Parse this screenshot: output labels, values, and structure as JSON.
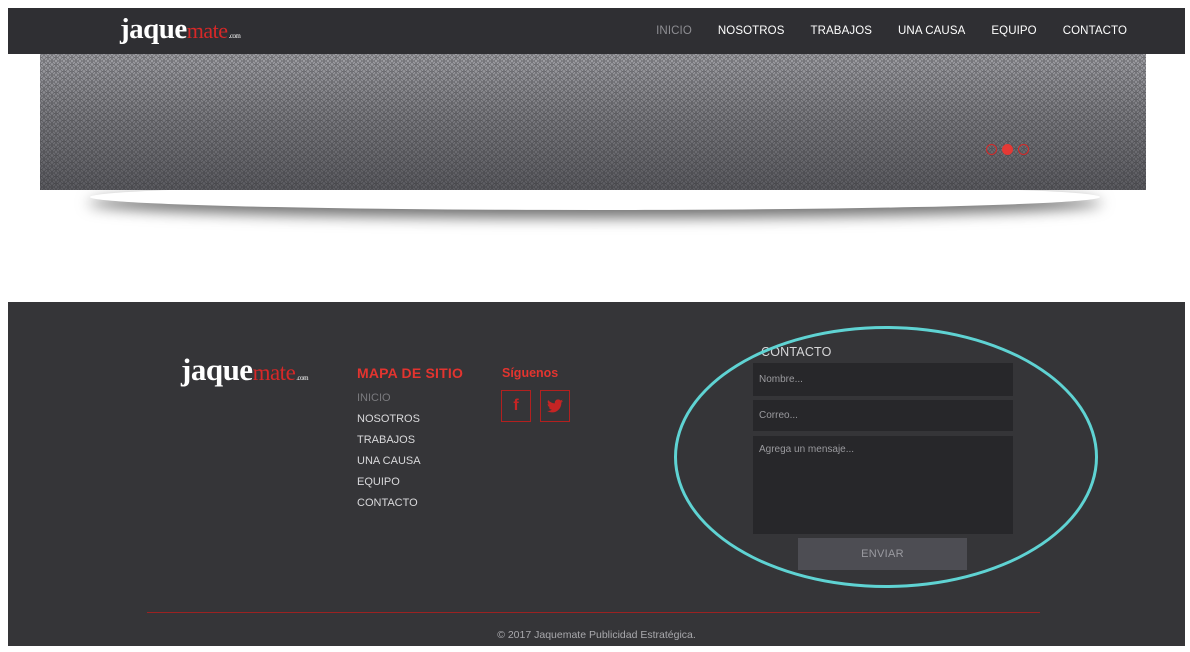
{
  "brand": {
    "logo_main": "jaque",
    "logo_accent": "mate",
    "logo_suffix": ".com"
  },
  "nav": {
    "items": [
      {
        "label": "INICIO",
        "active": true
      },
      {
        "label": "NOSOTROS",
        "active": false
      },
      {
        "label": "TRABAJOS",
        "active": false
      },
      {
        "label": "UNA CAUSA",
        "active": false
      },
      {
        "label": "EQUIPO",
        "active": false
      },
      {
        "label": "CONTACTO",
        "active": false
      }
    ]
  },
  "slider": {
    "slide_count": 3,
    "active_slide": 2
  },
  "footer": {
    "sitemap_title": "MAPA DE SITIO",
    "sitemap_items": [
      "INICIO",
      "NOSOTROS",
      "TRABAJOS",
      "UNA CAUSA",
      "EQUIPO",
      "CONTACTO"
    ],
    "follow_title": "Síguenos",
    "social": [
      {
        "name": "facebook-icon"
      },
      {
        "name": "twitter-icon"
      }
    ],
    "contact": {
      "title": "CONTACTO",
      "name_placeholder": "Nombre...",
      "email_placeholder": "Correo...",
      "message_placeholder": "Agrega un mensaje...",
      "send_label": "ENVIAR"
    },
    "copyright": "© 2017 Jaquemate Publicidad Estratégica."
  },
  "colors": {
    "nav_bg": "#2f2f33",
    "footer_bg": "#353538",
    "accent_red": "#e3342f",
    "highlight_ring": "#5fd3d3"
  }
}
